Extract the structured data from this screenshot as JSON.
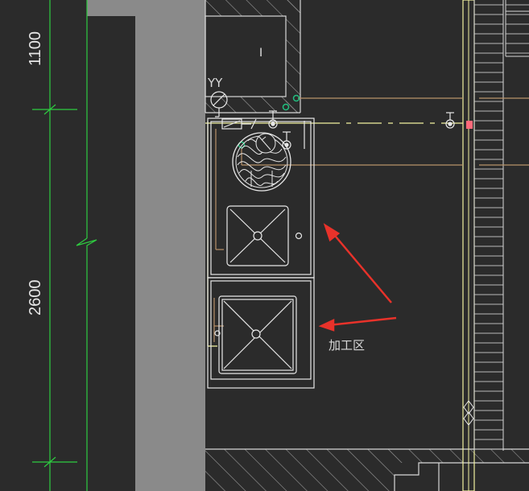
{
  "drawing": {
    "dimension_top": "1100",
    "dimension_bottom": "2600",
    "equipment_label": "YY",
    "room_mark": "I",
    "annotation": "加工区"
  },
  "colors": {
    "background": "#2b2b2b",
    "wall_gray": "#8a8a8a",
    "dimension_green": "#2ecc40",
    "pipe_yellow": "#f2f2a0",
    "pipe_tan": "#b8926a",
    "equipment_white": "#e8e8e8",
    "arrow_red": "#e8322a",
    "hatch_gray": "#9a9a9a",
    "pipe_green_dot": "#22c080",
    "pink_marker": "#ff6a7a"
  }
}
